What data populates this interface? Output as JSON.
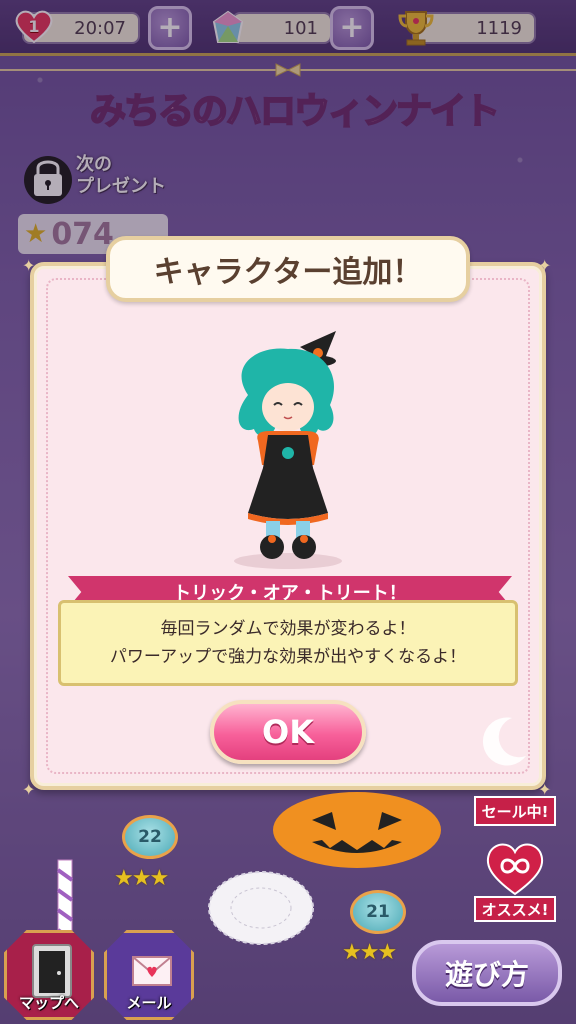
{
  "header": {
    "lives": "1",
    "timer": "20:07",
    "gems": "101",
    "trophies": "1119"
  },
  "event": {
    "title": "みちるのハロウィンナイト"
  },
  "present": {
    "label": "次の\nプレゼント",
    "count": "074"
  },
  "modal": {
    "title": "キャラクター追加！",
    "skill_name": "トリック・オア・トリート！",
    "description_line1": "毎回ランダムで効果が変わるよ！",
    "description_line2": "パワーアップで強力な効果が出やすくなるよ！",
    "ok_label": "OK"
  },
  "map": {
    "level_22": "22",
    "level_21": "21",
    "level_22_stars": 3,
    "level_21_stars": 3
  },
  "side": {
    "sale_label": "セール中!",
    "recommend_label": "オススメ!"
  },
  "footer": {
    "map_label": "マップへ",
    "mail_label": "メール",
    "howto_label": "遊び方"
  },
  "colors": {
    "accent_pink": "#f7609a",
    "banner_red": "#d0356c",
    "background_purple": "#7d62aa"
  }
}
